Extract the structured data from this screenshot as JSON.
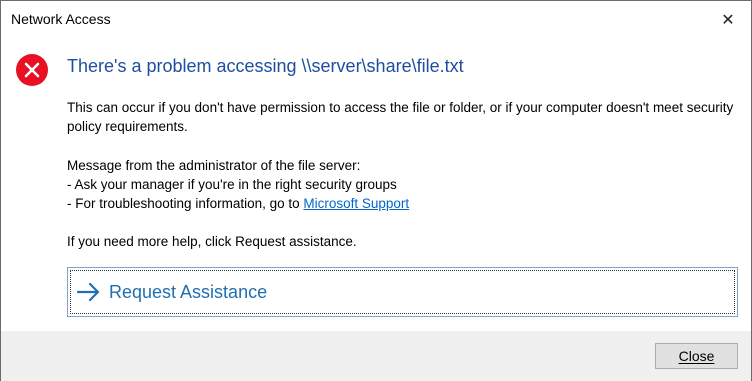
{
  "window": {
    "title": "Network Access",
    "close_glyph": "✕"
  },
  "dialog": {
    "icon": "error-icon",
    "heading": "There's a problem accessing \\\\server\\share\\file.txt",
    "paragraph1": "This can occur if you don't have permission to access the file or folder, or if your computer doesn't meet security policy requirements.",
    "admin_message_label": "Message from the administrator of the file server:",
    "admin_line1": "- Ask your manager if you're in the right security groups",
    "admin_line2_prefix": "- For troubleshooting information, go to ",
    "admin_line2_link": "Microsoft Support",
    "help_text": "If you need more help, click Request assistance.",
    "assist_button_label": "Request Assistance"
  },
  "footer": {
    "close_button_label": "Close"
  },
  "colors": {
    "error_red": "#e81123",
    "heading_blue": "#1f4ea0",
    "link_blue": "#0066cc",
    "assist_blue": "#1f6fb2",
    "footer_bg": "#f0f0f0"
  }
}
